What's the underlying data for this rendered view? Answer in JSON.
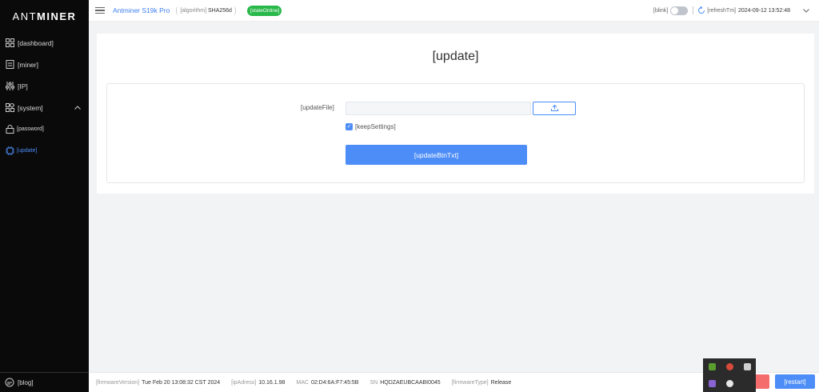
{
  "sidebar": {
    "logo_thin": "ANT",
    "logo_bold": "MINER",
    "items": [
      {
        "label": "[dashboard]",
        "icon": "grid-icon"
      },
      {
        "label": "[miner]",
        "icon": "document-icon"
      },
      {
        "label": "[IP]",
        "icon": "sliders-icon"
      },
      {
        "label": "[system]",
        "icon": "apps-icon"
      }
    ],
    "sub_items": [
      {
        "label": "[password]",
        "icon": "lock-icon"
      },
      {
        "label": "[update]",
        "icon": "chip-icon"
      }
    ],
    "blog_label": "[blog]"
  },
  "header": {
    "model": "Antminer S19k Pro",
    "algo_key": "[algorithm]",
    "algo_value": "SHA256d",
    "state": "[stateOnline]",
    "blink_label": "[blink]",
    "refresh_label": "[refreshTm]",
    "time": "2024-09-12 13:52:48"
  },
  "main": {
    "title": "[update]",
    "file_label": "[updateFile]",
    "keep_label": "[keepSettings]",
    "keep_checked": true,
    "submit_label": "[updateBtnTxt]"
  },
  "footer": {
    "firmware_key": "[firmwareVersion]",
    "firmware_value": "Tue Feb 20 13:08:32 CST 2024",
    "ip_key": "[ipAdress]",
    "ip_value": "10.16.1.98",
    "mac_key": "MAC",
    "mac_value": "02:D4:6A:F7:45:5B",
    "sn_key": "SN",
    "sn_value": "HQDZAEUBCAABI0045",
    "type_key": "[firmwareType]",
    "type_value": "Release",
    "restart_label": "[restart]"
  },
  "colors": {
    "accent": "#4d8df7",
    "online": "#29b84a",
    "sidebar_bg": "#0a0a0a"
  }
}
